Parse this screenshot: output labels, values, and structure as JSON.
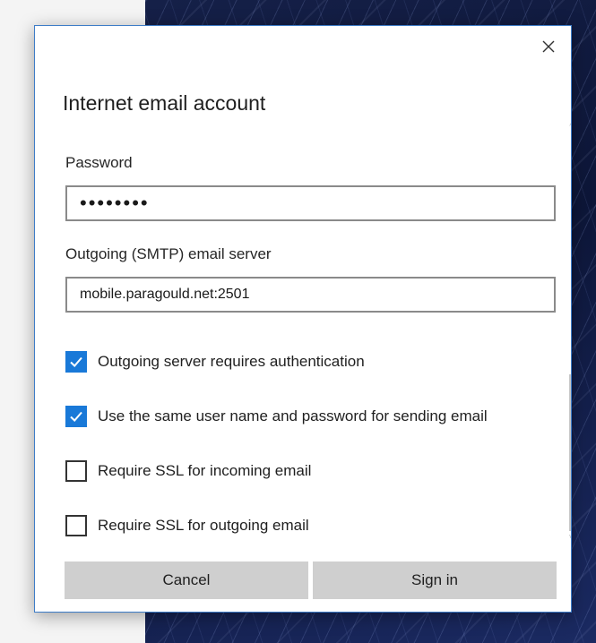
{
  "dialog": {
    "title": "Internet email account",
    "close_icon": "close-icon"
  },
  "password": {
    "label": "Password",
    "value": "••••••••"
  },
  "smtp": {
    "label": "Outgoing (SMTP) email server",
    "value": "mobile.paragould.net:2501"
  },
  "options": [
    {
      "label": "Outgoing server requires authentication",
      "checked": true
    },
    {
      "label": "Use the same user name and password for sending email",
      "checked": true
    },
    {
      "label": "Require SSL for incoming email",
      "checked": false
    },
    {
      "label": "Require SSL for outgoing email",
      "checked": false
    }
  ],
  "buttons": {
    "cancel": "Cancel",
    "sign_in": "Sign in"
  },
  "colors": {
    "accent": "#1979d8",
    "dialog_border": "#3d7cc7",
    "button_bg": "#cfcfcf"
  }
}
